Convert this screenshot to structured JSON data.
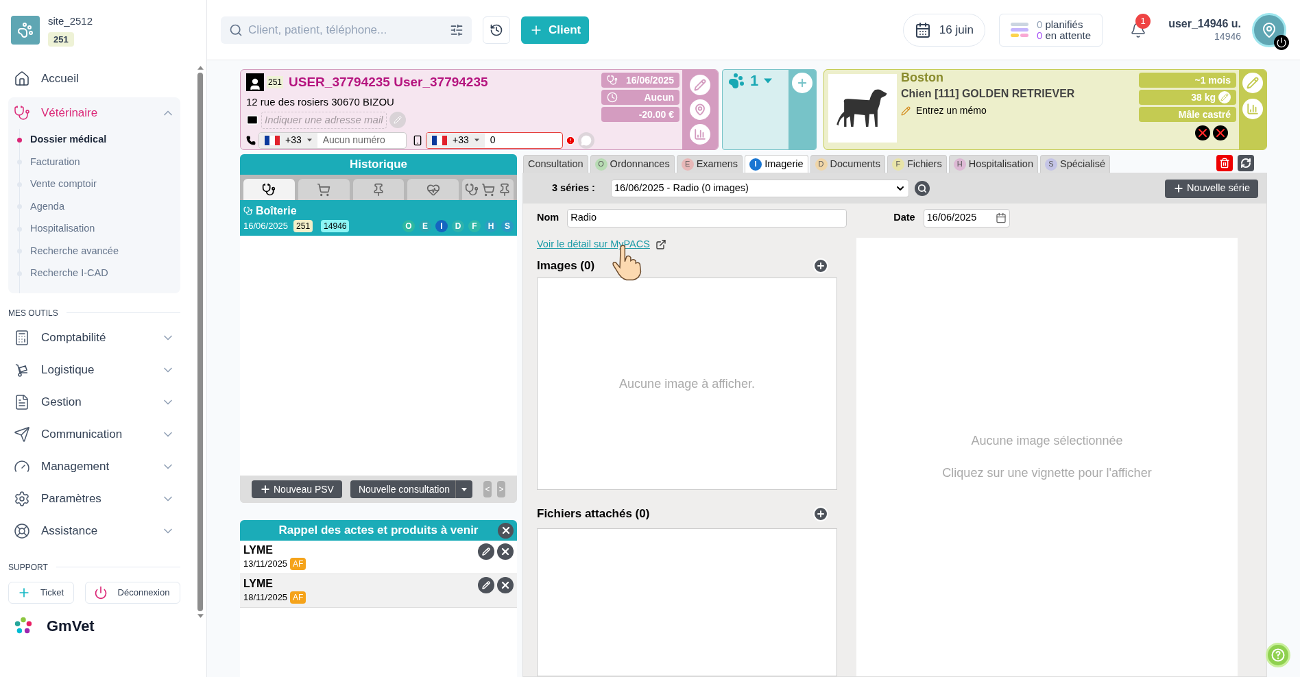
{
  "sidebar": {
    "site": "site_2512",
    "site_badge": "251",
    "nav": [
      {
        "label": "Accueil",
        "selected": false
      },
      {
        "label": "Vétérinaire",
        "selected": true,
        "expanded": true,
        "children": [
          {
            "label": "Dossier médical",
            "selected": true
          },
          {
            "label": "Facturation",
            "selected": false
          },
          {
            "label": "Vente comptoir",
            "selected": false
          },
          {
            "label": "Agenda",
            "selected": false
          },
          {
            "label": "Hospitalisation",
            "selected": false
          },
          {
            "label": "Recherche avancée",
            "selected": false
          },
          {
            "label": "Recherche I-CAD",
            "selected": false
          }
        ]
      }
    ],
    "tools_heading": "MES OUTILS",
    "tools": [
      {
        "label": "Comptabilité",
        "expanded": false
      },
      {
        "label": "Logistique",
        "expanded": false
      },
      {
        "label": "Gestion",
        "expanded": false
      },
      {
        "label": "Communication",
        "expanded": false
      },
      {
        "label": "Management",
        "expanded": false
      },
      {
        "label": "Paramètres",
        "expanded": false
      },
      {
        "label": "Assistance",
        "expanded": false
      }
    ],
    "support_heading": "SUPPORT",
    "support_buttons": [
      "Ticket",
      "Déconnexion"
    ],
    "brand": "GmVet"
  },
  "topbar": {
    "search": {
      "placeholder": "Client, patient, téléphone..."
    },
    "client_button": "Client",
    "date": "16 juin",
    "planned_count": "0",
    "planned_label": "planifiés",
    "waiting_count": "0",
    "waiting_label": "en attente",
    "notifications": "1",
    "user_name": "user_14946 u.",
    "user_id": "14946"
  },
  "client": {
    "badge": "251",
    "name": "USER_37794235 User_37794235",
    "address": "12 rue des rosiers 30670 BIZOU",
    "email": {
      "placeholder": "Indiquer une adresse mail"
    },
    "phone": {
      "code": "+33",
      "placeholder": "Aucun numéro"
    },
    "mobile": {
      "code": "+33",
      "value": "0",
      "error": true
    },
    "last_visit": "16/06/2025",
    "appointment": "Aucun",
    "balance": "-20.00 €"
  },
  "pets": {
    "count": "1"
  },
  "patient": {
    "name": "Boston",
    "breed": "Chien [111] GOLDEN RETRIEVER",
    "memo": "Entrez un mémo",
    "age": "~1 mois",
    "weight": "38 kg",
    "sex": "Mâle castré"
  },
  "history": {
    "title": "Historique",
    "tabs": [
      {
        "selected": true
      },
      {
        "selected": false
      },
      {
        "selected": false
      },
      {
        "selected": false
      },
      {
        "selected": false
      }
    ],
    "entries": [
      {
        "title": "Boîterie",
        "date": "16/06/2025",
        "badge": "251",
        "id": "14946",
        "selected": true,
        "letters": [
          {
            "label": "O",
            "color": "#2fb8a0"
          },
          {
            "label": "E",
            "color": "#2aa5b0"
          },
          {
            "label": "I",
            "color": "#1565c0"
          },
          {
            "label": "D",
            "color": "#2fb3ad"
          },
          {
            "label": "F",
            "color": "#2fb8a8"
          },
          {
            "label": "H",
            "color": "#2b9fc0"
          },
          {
            "label": "S",
            "color": "#2a9ac4"
          }
        ]
      }
    ],
    "buttons": [
      "Nouveau PSV",
      "Nouvelle consultation"
    ],
    "prev": "<",
    "next": ">"
  },
  "reminders": {
    "title": "Rappel des actes et produits à venir",
    "items": [
      {
        "name": "LYME",
        "date": "13/11/2025",
        "tag": "AF"
      },
      {
        "name": "LYME",
        "date": "18/11/2025",
        "tag": "AF"
      }
    ]
  },
  "record_tabs": [
    {
      "label": "Consultation",
      "selected": false
    },
    {
      "label": "Ordonnances",
      "letter": "O",
      "color": "#b8dcb4",
      "selected": false
    },
    {
      "label": "Examens",
      "letter": "E",
      "color": "#e8b8b8",
      "selected": false
    },
    {
      "label": "Imagerie",
      "letter": "I",
      "color": "#1976d2",
      "selected": true
    },
    {
      "label": "Documents",
      "letter": "D",
      "color": "#f0d6a8",
      "selected": false
    },
    {
      "label": "Fichiers",
      "letter": "F",
      "color": "#e8e4a8",
      "selected": false
    },
    {
      "label": "Hospitalisation",
      "letter": "H",
      "color": "#dcb8d4",
      "selected": false
    },
    {
      "label": "Spécialisé",
      "letter": "S",
      "color": "#c4c4e6",
      "selected": false
    }
  ],
  "imaging": {
    "series_label": "3 séries :",
    "series_value": "16/06/2025 - Radio (0 images)",
    "new_series": "Nouvelle série",
    "name_label": "Nom",
    "name_value": "Radio",
    "date_label": "Date",
    "date_value": "16/06/2025",
    "link": "Voir le détail sur MyPACS",
    "images_heading": "Images (0)",
    "images_empty": "Aucune image à afficher.",
    "files_heading": "Fichiers attachés (0)",
    "preview_title": "Aucune image sélectionnée",
    "preview_hint": "Cliquez sur une vignette pour l'afficher"
  }
}
